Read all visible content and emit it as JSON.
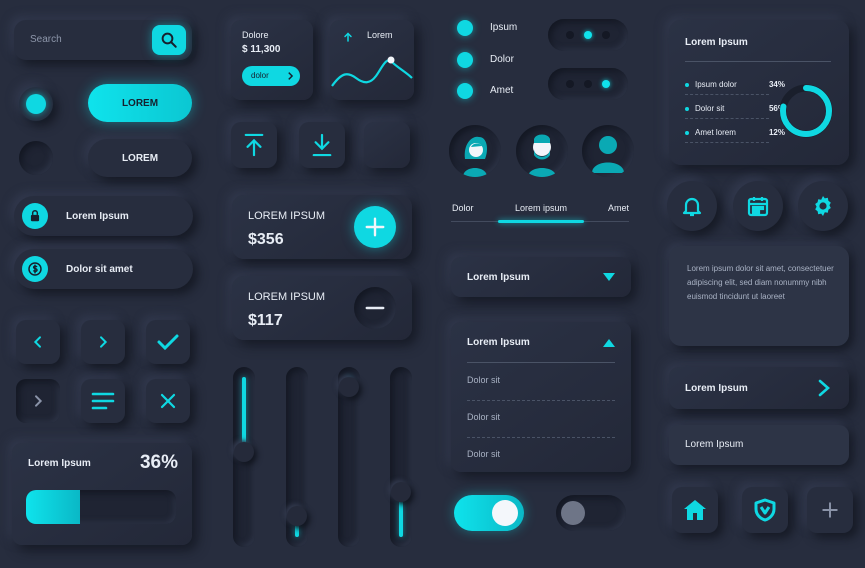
{
  "search": {
    "placeholder": "Search",
    "icon": "search-icon"
  },
  "buttons": {
    "primary": "LOREM",
    "secondary": "LOREM"
  },
  "icon_pills": [
    {
      "label": "Lorem Ipsum",
      "icon": "lock-icon"
    },
    {
      "label": "Dolor sit amet",
      "icon": "dollar-icon"
    }
  ],
  "progress": {
    "title": "Lorem Ipsum",
    "percent_label": "36%",
    "percent": 36
  },
  "balance": {
    "title": "Dolore",
    "value": "$ 11,300",
    "button": "dolor"
  },
  "graph": {
    "title": "Lorem"
  },
  "amounts": [
    {
      "title": "LOREM IPSUM",
      "value": "$356",
      "action": "plus"
    },
    {
      "title": "LOREM IPSUM",
      "value": "$117",
      "action": "minus"
    }
  ],
  "sliders": [
    {
      "level": 0.47,
      "fill": "top"
    },
    {
      "level": 0.87,
      "fill": "bottom"
    },
    {
      "level": 0.06,
      "fill": "top"
    },
    {
      "level": 0.72,
      "fill": "bottom"
    }
  ],
  "radio_list": [
    "Ipsum",
    "Dolor",
    "Amet"
  ],
  "dot_toggles": [
    {
      "active": 2
    },
    {
      "active": 3
    }
  ],
  "tabs": [
    "Dolor",
    "Lorem ipsum",
    "Amet"
  ],
  "active_tab": 1,
  "dropdown_collapsed": {
    "label": "Lorem Ipsum"
  },
  "dropdown_expanded": {
    "label": "Lorem Ipsum",
    "options": [
      "Dolor sit",
      "Dolor sit",
      "Dolor sit"
    ]
  },
  "toggles": {
    "first_on": true,
    "second_on": false
  },
  "stats": {
    "title": "Lorem Ipsum",
    "rows": [
      {
        "name": "Ipsum dolor",
        "value": "34%"
      },
      {
        "name": "Dolor sit",
        "value": "56%"
      },
      {
        "name": "Amet lorem",
        "value": "12%"
      }
    ],
    "donut_fraction": 0.78
  },
  "round_icons": [
    "bell-icon",
    "calendar-icon",
    "gear-icon"
  ],
  "text_card": "Lorem ipsum dolor sit amet, consectetuer adipiscing elit, sed diam nonummy nibh euismod tincidunt ut laoreet",
  "nav_cards": [
    {
      "label": "Lorem Ipsum"
    },
    {
      "label": "Lorem Ipsum"
    }
  ],
  "bottom_icons": [
    "home-icon",
    "shield-icon",
    "plus-icon"
  ],
  "colors": {
    "accent": "#0fd8e2",
    "background": "#272d3e"
  }
}
